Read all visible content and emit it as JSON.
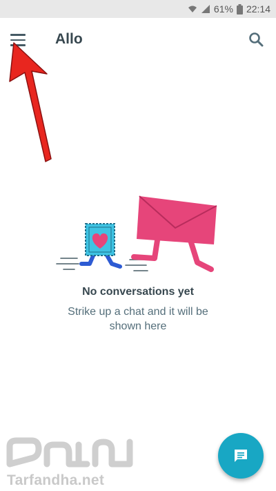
{
  "status_bar": {
    "battery_percent": "61%",
    "time": "22:14",
    "icons": [
      "wifi-icon",
      "signal-icon",
      "battery-icon"
    ]
  },
  "app_bar": {
    "title": "Allo",
    "menu_icon": "hamburger-menu-icon",
    "search_icon": "search-icon"
  },
  "empty_state": {
    "illustration": "running-stamp-and-envelope",
    "title": "No conversations yet",
    "subtitle": "Strike up a chat and it will be shown here"
  },
  "fab": {
    "icon": "chat-message-icon"
  },
  "watermark": {
    "text": "Tarfandha.net"
  },
  "annotation": {
    "icon": "red-arrow-pointer"
  },
  "colors": {
    "accent": "#18a7c4",
    "envelope": "#e6457a",
    "stamp": "#3ec3e3",
    "status_bar": "#e8e8e8",
    "arrow": "#e8261f"
  }
}
